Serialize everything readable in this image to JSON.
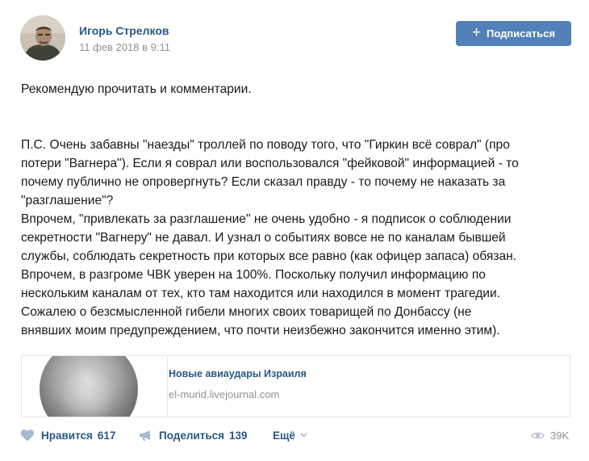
{
  "author": {
    "name": "Игорь Стрелков",
    "date": "11 фев 2018 в 9:11"
  },
  "subscribe": {
    "label": "Подписаться",
    "icon": "plus-icon",
    "color": "#5181b8"
  },
  "post": {
    "lines_block1": [
      "Рекомендую прочитать и комментарии."
    ],
    "lines_block2": [
      "П.С. Очень забавны \"наезды\" троллей по поводу того, что \"Гиркин всё соврал\" (про",
      "потери \"Вагнера\"). Если я соврал или воспользовался \"фейковой\" информацией - то",
      "почему публично не опровергнуть? Если сказал правду - то почему не наказать за",
      "\"разглашение\"?",
      "Впрочем, \"привлекать за разглашение\" не очень удобно - я подписок о соблюдении",
      "секретности \"Вагнеру\" не давал. И узнал о событиях вовсе не по каналам бывшей",
      "службы, соблюдать секретность при которых все равно (как офицер запаса) обязан.",
      "Впрочем, в разгроме ЧВК уверен на 100%. Поскольку получил информацию по",
      "нескольким каналам от тех, кто там находится или находился в момент трагедии.",
      "Сожалею о безсмысленной гибели многих своих товарищей по Донбассу (не",
      "внявших моим предупреждением, что почти неизбежно закончится именно этим)."
    ]
  },
  "link_card": {
    "title": "Новые авиаудары Израиля",
    "domain": "el-murid.livejournal.com"
  },
  "actions": {
    "like": {
      "label": "Нравится",
      "count": "617",
      "icon": "heart-icon"
    },
    "share": {
      "label": "Поделиться",
      "count": "139",
      "icon": "megaphone-icon"
    },
    "more": {
      "label": "Ещё",
      "icon": "chevron-down-icon"
    },
    "views": {
      "count": "39K",
      "icon": "eye-icon"
    }
  },
  "colors": {
    "link": "#2a5885",
    "muted": "#939393",
    "icon": "#a9b9cd"
  }
}
